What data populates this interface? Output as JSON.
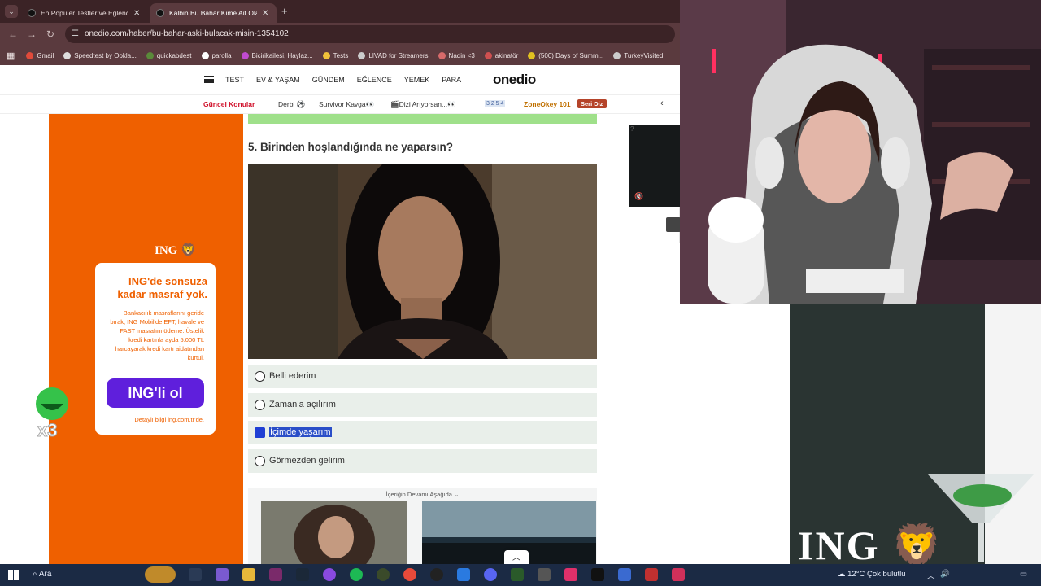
{
  "browser": {
    "tabs": [
      {
        "title": "En Popüler Testler ve Eğlenceli",
        "active": false
      },
      {
        "title": "Kalbin Bu Bahar Kime Ait Olacak",
        "active": true
      }
    ],
    "url": "onedio.com/haber/bu-bahar-aski-bulacak-misin-1354102",
    "bookmarks": [
      {
        "label": "Gmail",
        "color": "#e04a3a"
      },
      {
        "label": "Speedtest by Ookla...",
        "color": "#dddddd"
      },
      {
        "label": "quickabdest",
        "color": "#5a8a3a"
      },
      {
        "label": "parolla",
        "color": "#ffffff"
      },
      {
        "label": "Bicirikailesi, Haylaz...",
        "color": "#c04bd0"
      },
      {
        "label": "Tests",
        "color": "#f0c23a"
      },
      {
        "label": "LIVAD for Streamers",
        "color": "#cccccc"
      },
      {
        "label": "Nadin <3",
        "color": "#d66a6a"
      },
      {
        "label": "akinatör",
        "color": "#d05050"
      },
      {
        "label": "(500) Days of Summ...",
        "color": "#e0c020"
      },
      {
        "label": "TurkeyVisited",
        "color": "#cccccc"
      }
    ]
  },
  "site": {
    "logo": "onedio",
    "nav": [
      "TEST",
      "EV & YAŞAM",
      "GÜNDEM",
      "EĞLENCE",
      "YEMEK",
      "PARA"
    ],
    "trending": {
      "hot_label": "Güncel Konular",
      "items": [
        "Derbi ⚽",
        "Survivor Kavga👀",
        "🎬Dizi Arıyorsan...👀"
      ],
      "numbers": "3 2 5 4",
      "zone": "ZoneOkey 101",
      "badge": "Seri Diz"
    }
  },
  "ad": {
    "brand": "ING",
    "headline": "ING'de sonsuza kadar masraf yok.",
    "body": "Bankacılık masraflarını geride bırak, ING Mobil'de EFT, havale ve FAST masrafını ödeme. Üstelik kredi kartınla ayda 5.000 TL harcayarak kredi kartı aidatından kurtul.",
    "cta": "ING'li ol",
    "footer": "Detaylı bilgi ing.com.tr'de."
  },
  "badge_overlay": "x3",
  "quiz": {
    "question": "5. Birinden hoşlandığında ne yaparsın?",
    "options": [
      {
        "label": "Belli ederim",
        "selected": false
      },
      {
        "label": "Zamanla açılırım",
        "selected": false
      },
      {
        "label": "İçimde yaşarım",
        "selected": true
      },
      {
        "label": "Görmezden gelirim",
        "selected": false
      }
    ],
    "continue_label": "İçeriğin Devamı Aşağıda ⌄"
  },
  "right_ad_brand": "ING",
  "taskbar": {
    "search": "Ara",
    "weather": "12°C  Çok bulutlu"
  }
}
